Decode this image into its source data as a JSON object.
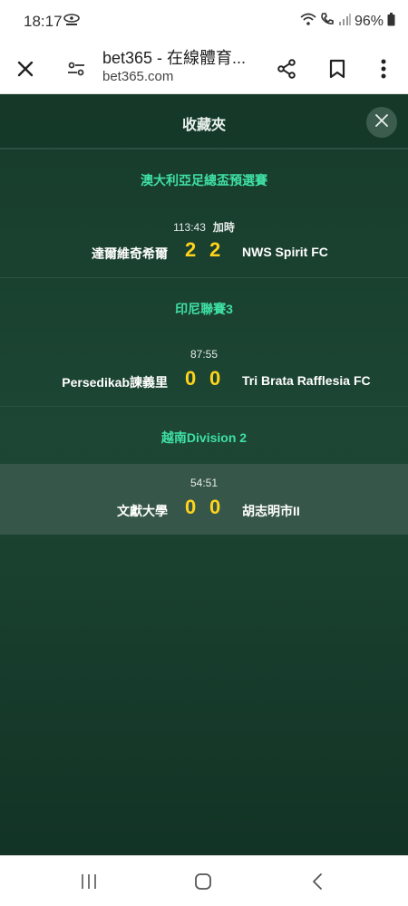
{
  "status_bar": {
    "time": "18:17",
    "battery": "96%",
    "icons": [
      "notification-icon",
      "wifi-icon",
      "call-icon",
      "signal-icon",
      "battery-icon"
    ]
  },
  "browser": {
    "title": "bet365 - 在線體育...",
    "domain": "bet365.com",
    "icons": [
      "close-icon",
      "tune-icon",
      "share-icon",
      "bookmark-icon",
      "more-icon"
    ]
  },
  "app": {
    "title": "收藏夾",
    "close_icon": "close-icon",
    "leagues": [
      {
        "name": "澳大利亞足總盃預選賽",
        "match": {
          "time": "113:43",
          "extra": "加時",
          "home": "達爾維奇希爾",
          "home_score": "2",
          "away_score": "2",
          "away": "NWS Spirit FC"
        }
      },
      {
        "name": "印尼聯賽3",
        "match": {
          "time": "87:55",
          "extra": "",
          "home": "Persedikab諫義里",
          "home_score": "0",
          "away_score": "0",
          "away": "Tri Brata Rafflesia FC"
        }
      },
      {
        "name": "越南Division 2",
        "match": {
          "time": "54:51",
          "extra": "",
          "home": "文獻大學",
          "home_score": "0",
          "away_score": "0",
          "away": "胡志明市II"
        }
      }
    ]
  },
  "colors": {
    "league_accent": "#3fe0a4",
    "score": "#ffd31a",
    "background": "#1d4634"
  },
  "nav": {
    "icons": [
      "recent-apps-icon",
      "home-icon",
      "back-icon"
    ]
  }
}
